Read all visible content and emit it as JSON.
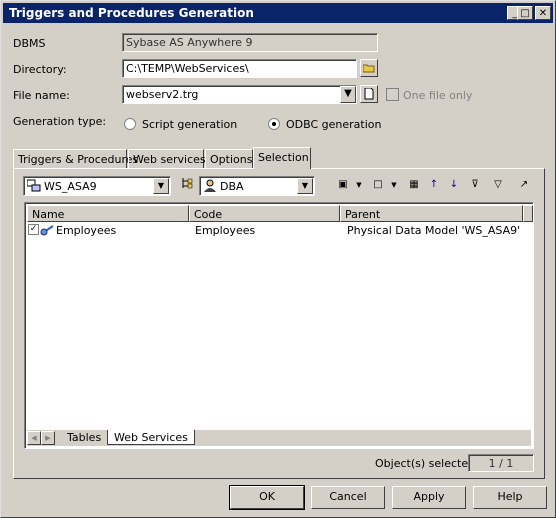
{
  "window": {
    "title": "Triggers and Procedures Generation",
    "minimize_label": "_",
    "maximize_label": "□",
    "close_label": "✕"
  },
  "form": {
    "dbms_label": "DBMS",
    "dbms_value": "Sybase AS Anywhere 9",
    "directory_label": "Directory:",
    "directory_value": "C:\\TEMP\\WebServices\\",
    "filename_label": "File name:",
    "filename_value": "webserv2.trg",
    "one_file_only_label": "One file only",
    "generation_type_label": "Generation type:",
    "script_generation_label": "Script generation",
    "odbc_generation_label": "ODBC generation"
  },
  "tabs": [
    {
      "label": "Triggers & Procedures"
    },
    {
      "label": "Web services"
    },
    {
      "label": "Options"
    },
    {
      "label": "Selection"
    }
  ],
  "selection": {
    "model_value": "WS_ASA9",
    "owner_value": "DBA",
    "columns": [
      "Name",
      "Code",
      "Parent"
    ],
    "rows": [
      {
        "name": "Employees",
        "code": "Employees",
        "parent": "Physical Data Model 'WS_ASA9'",
        "checked": true
      }
    ],
    "bottom_tabs": [
      "Tables",
      "Web Services"
    ],
    "selected_label": "Object(s) selected:",
    "selected_value": "1 / 1"
  },
  "buttons": {
    "ok": "OK",
    "cancel": "Cancel",
    "apply": "Apply",
    "help": "Help"
  },
  "colors": {
    "titlebar": "#0a246a",
    "dialog": "#d4d0c8"
  }
}
